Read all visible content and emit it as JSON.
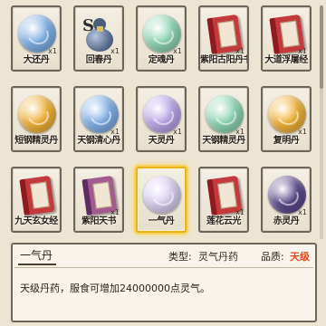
{
  "items": [
    {
      "name": "大还丹",
      "count": "x1",
      "icon": "pill-blue"
    },
    {
      "name": "回春丹",
      "count": "x1",
      "icon": "gourd-icon"
    },
    {
      "name": "定魂丹",
      "count": "x1",
      "icon": "pill-teal"
    },
    {
      "name": "紫阳古阳丹书",
      "count": "x1",
      "icon": "book-red"
    },
    {
      "name": "大道浮屠经",
      "count": "x1",
      "icon": "book-red"
    },
    {
      "name": "短钢精灵丹",
      "count": "",
      "icon": "pill-gold"
    },
    {
      "name": "天钢清心丹",
      "count": "x1",
      "icon": "pill-blue"
    },
    {
      "name": "天灵丹",
      "count": "x1",
      "icon": "pill-purple"
    },
    {
      "name": "天钢精灵丹",
      "count": "x1",
      "icon": "pill-teal"
    },
    {
      "name": "复明丹",
      "count": "x1",
      "icon": "pill-gold"
    },
    {
      "name": "九天玄女经",
      "count": "",
      "icon": "book-red"
    },
    {
      "name": "紫阳天书",
      "count": "x1",
      "icon": "book-purple"
    },
    {
      "name": "一气丹",
      "count": "",
      "icon": "pill-white"
    },
    {
      "name": "莲花云光",
      "count": "x1",
      "icon": "book-red"
    },
    {
      "name": "赤灵丹",
      "count": "x1",
      "icon": "pill-violet"
    }
  ],
  "selected_index": 12,
  "detail": {
    "name": "一气丹",
    "type_label": "类型:",
    "type_value": "灵气丹药",
    "quality_label": "品质:",
    "quality_value": "天级",
    "description": "天级丹药，服食可增加24000000点灵气。"
  },
  "colors": {
    "pill-blue": "#7fb0e6",
    "pill-teal": "#8fd6b6",
    "pill-gold": "#f2b33a",
    "pill-purple": "#b9a6e8",
    "pill-white": "#d9d0f0",
    "pill-violet": "#5b4a8a",
    "quality": "#e04a1e",
    "selected_border": "#e9b21d"
  }
}
